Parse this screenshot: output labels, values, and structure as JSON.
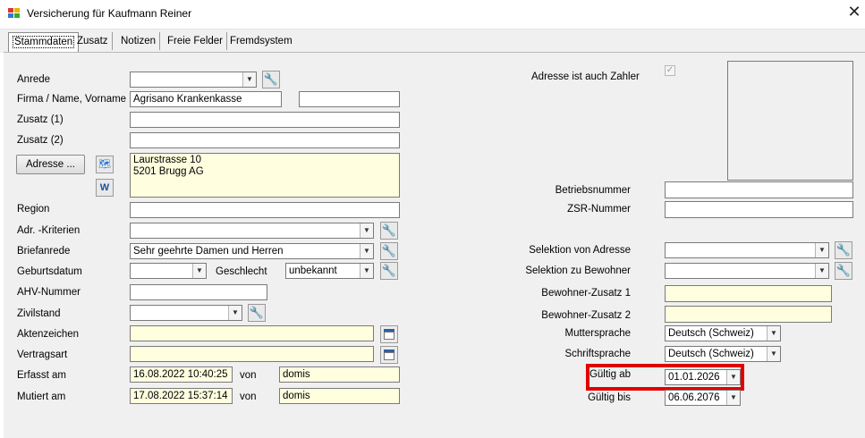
{
  "window": {
    "title": "Versicherung für Kaufmann Reiner"
  },
  "tabs": [
    "Stammdaten",
    "Zusatz",
    "Notizen",
    "Freie Felder",
    "Fremdsystem"
  ],
  "left": {
    "anrede": {
      "label": "Anrede",
      "value": ""
    },
    "firma": {
      "label": "Firma / Name, Vorname",
      "value": "Agrisano Krankenkasse",
      "value2": ""
    },
    "zusatz1": {
      "label": "Zusatz (1)",
      "value": ""
    },
    "zusatz2": {
      "label": "Zusatz (2)",
      "value": ""
    },
    "adresse": {
      "button": "Adresse ...",
      "line1": "Laurstrasse 10",
      "line2": "5201 Brugg AG"
    },
    "region": {
      "label": "Region",
      "value": ""
    },
    "adr_kriterien": {
      "label": "Adr. -Kriterien",
      "value": ""
    },
    "briefanrede": {
      "label": "Briefanrede",
      "value": "Sehr geehrte Damen und Herren"
    },
    "geburtsdatum": {
      "label": "Geburtsdatum",
      "value": ""
    },
    "geschlecht": {
      "label": "Geschlecht",
      "value": "unbekannt"
    },
    "ahv": {
      "label": "AHV-Nummer",
      "value": ""
    },
    "zivilstand": {
      "label": "Zivilstand",
      "value": ""
    },
    "aktenzeichen": {
      "label": "Aktenzeichen",
      "value": ""
    },
    "vertragsart": {
      "label": "Vertragsart",
      "value": ""
    },
    "erfasst": {
      "label": "Erfasst am",
      "value": "16.08.2022 10:40:25",
      "von_label": "von",
      "von": "domis"
    },
    "mutiert": {
      "label": "Mutiert am",
      "value": "17.08.2022 15:37:14",
      "von_label": "von",
      "von": "domis"
    }
  },
  "right": {
    "adresse_zahler": {
      "label": "Adresse ist auch Zahler",
      "checked": true
    },
    "betriebsnummer": {
      "label": "Betriebsnummer",
      "value": ""
    },
    "zsr": {
      "label": "ZSR-Nummer",
      "value": ""
    },
    "selektion_adresse": {
      "label": "Selektion von Adresse",
      "value": ""
    },
    "selektion_bewohner": {
      "label": "Selektion zu Bewohner",
      "value": ""
    },
    "bewohner_zusatz1": {
      "label": "Bewohner-Zusatz 1",
      "value": ""
    },
    "bewohner_zusatz2": {
      "label": "Bewohner-Zusatz 2",
      "value": ""
    },
    "muttersprache": {
      "label": "Muttersprache",
      "value": "Deutsch (Schweiz)"
    },
    "schriftsprache": {
      "label": "Schriftsprache",
      "value": "Deutsch (Schweiz)"
    },
    "gueltig_ab": {
      "label": "Gültig ab",
      "value": "01.01.2026"
    },
    "gueltig_bis": {
      "label": "Gültig bis",
      "value": "06.06.2076"
    }
  },
  "colors": {
    "highlight": "#e00000",
    "yellow_field": "#ffffe0",
    "panel": "#f0f0f0"
  },
  "icons": {
    "app": "app-icon",
    "wrench": "wrench-icon",
    "calendar": "calendar-icon",
    "close": "close-icon"
  }
}
